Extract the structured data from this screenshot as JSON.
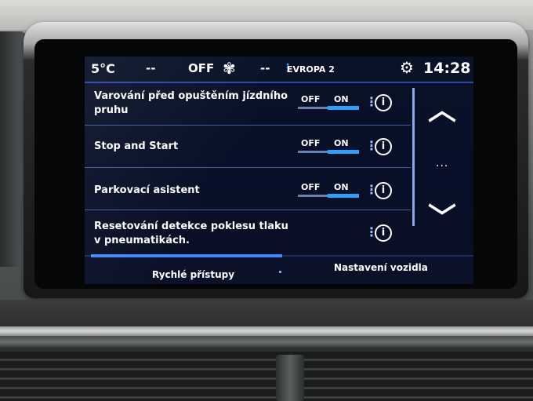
{
  "statusbar": {
    "temperature": "5°C",
    "left_dash": "--",
    "ac_status": "OFF",
    "fan_icon": "fan-icon",
    "right_dash": "--",
    "source_sep": "⋮",
    "radio_station": "EVROPA 2",
    "settings_icon": "gear-icon",
    "clock": "14:28"
  },
  "settings": [
    {
      "label": "Varování před opuštěním jízdního pruhu",
      "has_toggle": true,
      "off": "OFF",
      "on": "ON",
      "state": "ON"
    },
    {
      "label": "Stop and Start",
      "has_toggle": true,
      "off": "OFF",
      "on": "ON",
      "state": "ON"
    },
    {
      "label": "Parkovací asistent",
      "has_toggle": true,
      "off": "OFF",
      "on": "ON",
      "state": "ON"
    },
    {
      "label": "Resetování detekce poklesu tlaku v pneumatikách.",
      "has_toggle": false
    }
  ],
  "more_dots": "⋮",
  "info_glyph": "i",
  "nav": {
    "up": "︿",
    "more": "...",
    "down": "﹀"
  },
  "tabs": {
    "quick_access": "Rychlé přístupy",
    "vehicle_settings": "Nastavení vozidla"
  },
  "colors": {
    "accent": "#2aa0ff",
    "background": "#081029"
  }
}
